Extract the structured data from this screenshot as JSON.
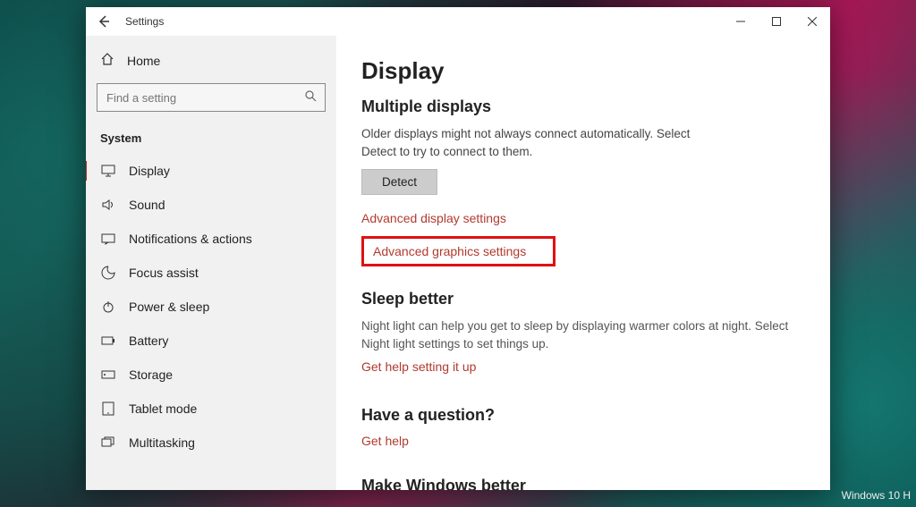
{
  "window": {
    "title": "Settings"
  },
  "sidebar": {
    "home_label": "Home",
    "search_placeholder": "Find a setting",
    "category": "System",
    "items": [
      {
        "label": "Display"
      },
      {
        "label": "Sound"
      },
      {
        "label": "Notifications & actions"
      },
      {
        "label": "Focus assist"
      },
      {
        "label": "Power & sleep"
      },
      {
        "label": "Battery"
      },
      {
        "label": "Storage"
      },
      {
        "label": "Tablet mode"
      },
      {
        "label": "Multitasking"
      }
    ]
  },
  "content": {
    "page_title": "Display",
    "multiple_displays": {
      "heading": "Multiple displays",
      "description": "Older displays might not always connect automatically. Select Detect to try to connect to them.",
      "detect_button": "Detect",
      "adv_display_link": "Advanced display settings",
      "adv_graphics_link": "Advanced graphics settings"
    },
    "sleep_better": {
      "heading": "Sleep better",
      "description": "Night light can help you get to sleep by displaying warmer colors at night. Select Night light settings to set things up.",
      "link": "Get help setting it up"
    },
    "question": {
      "heading": "Have a question?",
      "link": "Get help"
    },
    "make_better": {
      "heading": "Make Windows better"
    }
  },
  "watermark": "Windows 10 H"
}
